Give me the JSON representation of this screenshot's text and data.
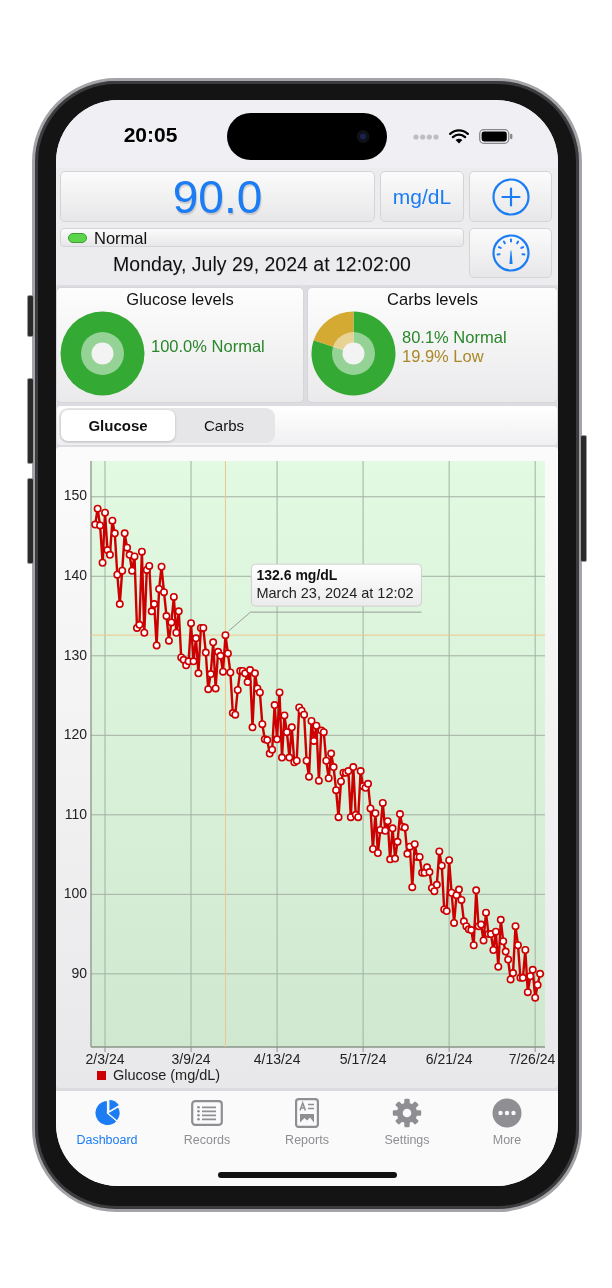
{
  "status_bar": {
    "time": "20:05"
  },
  "reading": {
    "value": "90.0",
    "unit": "mg/dL",
    "status": {
      "label": "Normal",
      "color": "#5bd64b"
    },
    "timestamp": "Monday, July 29, 2024 at 12:02:00"
  },
  "summary": [
    {
      "title": "Glucose levels",
      "chart_data": {
        "type": "donut",
        "values": [
          100.0
        ]
      },
      "legend": [
        {
          "text": "100.0% Normal",
          "color": "#34a934"
        }
      ]
    },
    {
      "title": "Carbs levels",
      "chart_data": {
        "type": "donut",
        "values": [
          80.1,
          19.9
        ]
      },
      "legend": [
        {
          "text": "80.1% Normal",
          "color": "#34a934"
        },
        {
          "text": "19.9% Low",
          "color": "#d4aa33"
        }
      ]
    }
  ],
  "chart": {
    "tabs": [
      {
        "label": "Glucose",
        "selected": true
      },
      {
        "label": "Carbs",
        "selected": false
      }
    ],
    "chart_data": {
      "type": "line",
      "categories": [
        null,
        null,
        null,
        null,
        "2/3/24",
        null,
        null,
        null,
        null,
        null,
        null,
        null,
        null,
        null,
        null,
        null,
        null,
        null,
        null,
        null,
        null,
        null,
        null,
        null,
        null,
        null,
        null,
        null,
        null,
        null,
        null,
        null,
        null,
        null,
        null,
        null,
        null,
        null,
        null,
        "3/9/24",
        null,
        null,
        null,
        null,
        null,
        null,
        null,
        null,
        null,
        null,
        null,
        null,
        null,
        null,
        null,
        null,
        null,
        null,
        null,
        null,
        null,
        null,
        null,
        null,
        null,
        null,
        null,
        null,
        null,
        null,
        null,
        null,
        null,
        null,
        "4/13/24",
        null,
        null,
        null,
        null,
        null,
        null,
        null,
        null,
        null,
        null,
        null,
        null,
        null,
        null,
        null,
        null,
        null,
        null,
        null,
        null,
        null,
        null,
        null,
        null,
        null,
        null,
        null,
        null,
        null,
        null,
        null,
        null,
        null,
        null,
        "5/17/24",
        null,
        null,
        null,
        null,
        null,
        null,
        null,
        null,
        null,
        null,
        null,
        null,
        null,
        null,
        null,
        null,
        null,
        null,
        null,
        null,
        null,
        null,
        null,
        null,
        null,
        null,
        null,
        null,
        null,
        null,
        null,
        null,
        null,
        null,
        "6/21/24",
        null,
        null,
        null,
        null,
        null,
        null,
        null,
        null,
        null,
        null,
        null,
        null,
        null,
        null,
        null,
        null,
        null,
        null,
        null,
        null,
        null,
        null,
        null,
        null,
        null,
        null,
        null,
        null,
        null,
        null,
        null,
        null,
        null,
        null,
        "7/26/24",
        null,
        null
      ],
      "series": [
        {
          "name": "Glucose (mg/dL)",
          "color": "#cc0000",
          "marker": "circle",
          "values": [
            146.5,
            148.5,
            146.4,
            141.7,
            148.0,
            143.3,
            142.7,
            147.0,
            145.4,
            140.2,
            136.5,
            140.7,
            145.4,
            143.6,
            142.7,
            140.7,
            142.5,
            133.5,
            133.9,
            143.1,
            132.9,
            140.8,
            141.3,
            135.6,
            136.5,
            131.3,
            138.4,
            141.2,
            138.0,
            135.0,
            131.9,
            134.2,
            137.4,
            132.9,
            135.6,
            129.8,
            129.5,
            128.8,
            129.3,
            134.1,
            129.3,
            132.2,
            127.8,
            133.5,
            133.5,
            130.4,
            125.8,
            127.7,
            131.7,
            125.9,
            130.5,
            130.0,
            128.0,
            132.6,
            130.3,
            127.9,
            122.8,
            122.6,
            125.7,
            128.1,
            128.1,
            127.8,
            126.7,
            128.2,
            121.0,
            127.8,
            125.9,
            125.4,
            121.4,
            119.5,
            119.4,
            117.7,
            118.2,
            123.8,
            119.5,
            125.4,
            117.2,
            122.5,
            120.4,
            117.2,
            121.0,
            116.6,
            116.8,
            123.5,
            123.1,
            122.6,
            116.8,
            114.8,
            121.8,
            119.3,
            121.2,
            114.3,
            120.6,
            120.4,
            116.8,
            114.6,
            117.7,
            116.0,
            113.1,
            109.7,
            114.2,
            115.3,
            115.3,
            115.5,
            109.7,
            116.0,
            110.0,
            109.7,
            115.5,
            113.6,
            113.4,
            113.9,
            110.8,
            105.7,
            110.2,
            105.2,
            108.1,
            111.5,
            108.0,
            109.2,
            104.4,
            108.3,
            104.5,
            106.6,
            110.1,
            108.5,
            108.4,
            105.1,
            106.0,
            100.9,
            106.3,
            104.7,
            104.7,
            102.7,
            102.7,
            103.4,
            102.8,
            100.8,
            100.4,
            101.2,
            105.4,
            103.6,
            98.1,
            97.9,
            104.3,
            100.2,
            96.4,
            99.9,
            100.6,
            99.3,
            96.6,
            96.0,
            95.6,
            95.5,
            93.6,
            100.5,
            96.0,
            96.2,
            94.2,
            97.7,
            95.0,
            95.0,
            93.0,
            95.3,
            90.9,
            96.8,
            94.1,
            92.8,
            91.8,
            89.3,
            90.1,
            96.0,
            93.6,
            89.5,
            89.5,
            93.0,
            87.7,
            89.7,
            90.5,
            87.0,
            88.6,
            90.0
          ]
        }
      ],
      "ylim": [
        80.8,
        154.5
      ],
      "yticks": [
        90,
        100,
        110,
        120,
        130,
        140,
        150
      ],
      "grid": true,
      "ref_lines": [
        {
          "axis": "y",
          "value": 132.6
        }
      ],
      "annotations": [
        "132.6 mg/dL"
      ]
    },
    "tooltip": {
      "detail": "March 23, 2024 at 12:02"
    }
  },
  "tabbar": {
    "items": [
      {
        "label": "Dashboard",
        "selected": true
      },
      {
        "label": "Records",
        "selected": false
      },
      {
        "label": "Reports",
        "selected": false
      },
      {
        "label": "Settings",
        "selected": false
      },
      {
        "label": "More",
        "selected": false
      }
    ]
  }
}
